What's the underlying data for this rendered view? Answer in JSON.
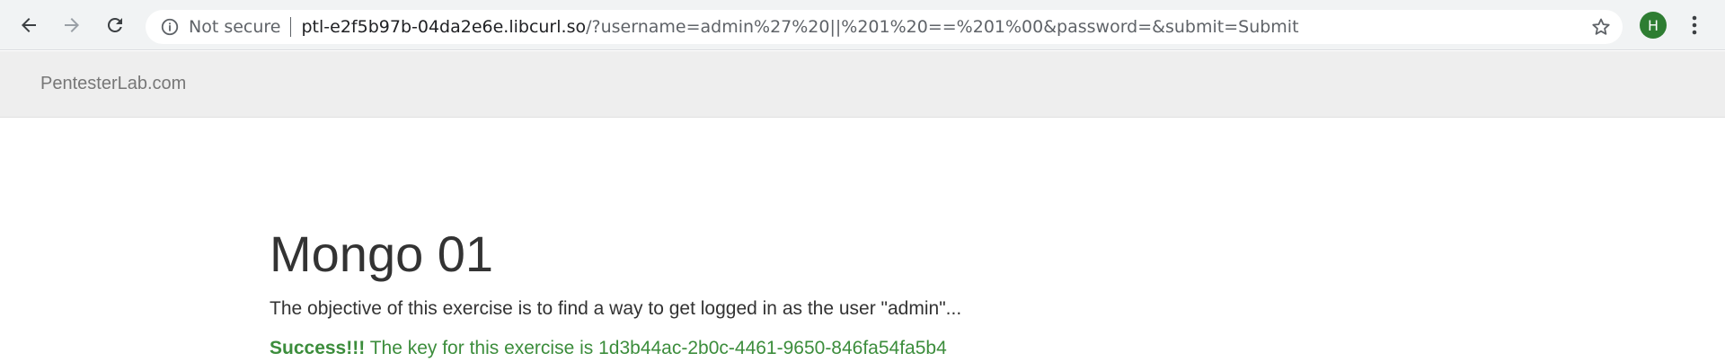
{
  "browser": {
    "security_label": "Not secure",
    "url_host": "ptl-e2f5b97b-04da2e6e.libcurl.so",
    "url_rest": "/?username=admin%27%20||%201%20==%201%00&password=&submit=Submit",
    "avatar_letter": "H",
    "icons": {
      "back": "arrow-left-icon",
      "forward": "arrow-right-icon",
      "reload": "reload-icon",
      "info": "info-icon",
      "bookmark": "star-icon",
      "menu": "kebab-menu-icon"
    }
  },
  "site": {
    "brand": "PentesterLab.com"
  },
  "main": {
    "title": "Mongo 01",
    "objective": "The objective of this exercise is to find a way to get logged in as the user \"admin\"...",
    "success_label": "Success!!!",
    "success_message": "The key for this exercise is 1d3b44ac-2b0c-4461-9650-846fa54fa5b4"
  },
  "colors": {
    "toolbar_bg": "#f1f3f4",
    "navbar_bg": "#eeeeee",
    "success_green": "#3c8d3c",
    "avatar_green": "#2e7d32"
  }
}
